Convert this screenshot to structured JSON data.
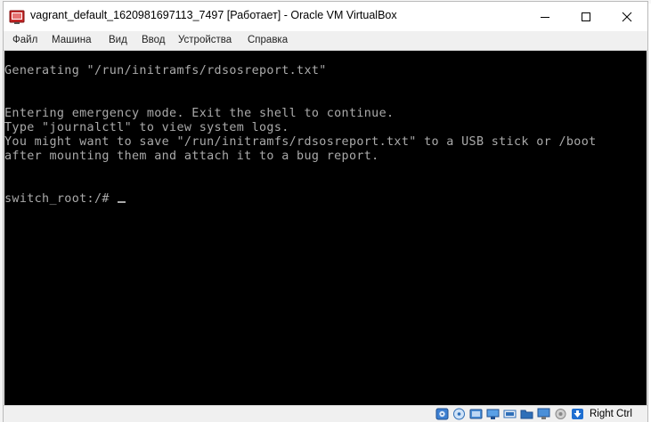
{
  "window": {
    "title": "vagrant_default_1620981697113_7497 [Работает] - Oracle VM VirtualBox"
  },
  "menu": {
    "items": [
      "Файл",
      "Машина",
      "Вид",
      "Ввод",
      "Устройства",
      "Справка"
    ]
  },
  "console": {
    "lines": [
      "Generating \"/run/initramfs/rdsosreport.txt\"",
      "",
      "",
      "Entering emergency mode. Exit the shell to continue.",
      "Type \"journalctl\" to view system logs.",
      "You might want to save \"/run/initramfs/rdsosreport.txt\" to a USB stick or /boot",
      "after mounting them and attach it to a bug report.",
      "",
      "",
      "switch_root:/# "
    ]
  },
  "statusbar": {
    "icons": [
      "hard-disk-icon",
      "optical-drive-icon",
      "audio-icon",
      "network-icon",
      "usb-icon",
      "shared-folders-icon",
      "display-icon",
      "video-capture-icon",
      "mouse-integration-icon",
      "arrow-down-icon"
    ],
    "host_key": "Right Ctrl"
  },
  "colors": {
    "console_bg": "#000000",
    "console_fg": "#aaaaaa",
    "chrome_bg": "#f0f0f0"
  }
}
